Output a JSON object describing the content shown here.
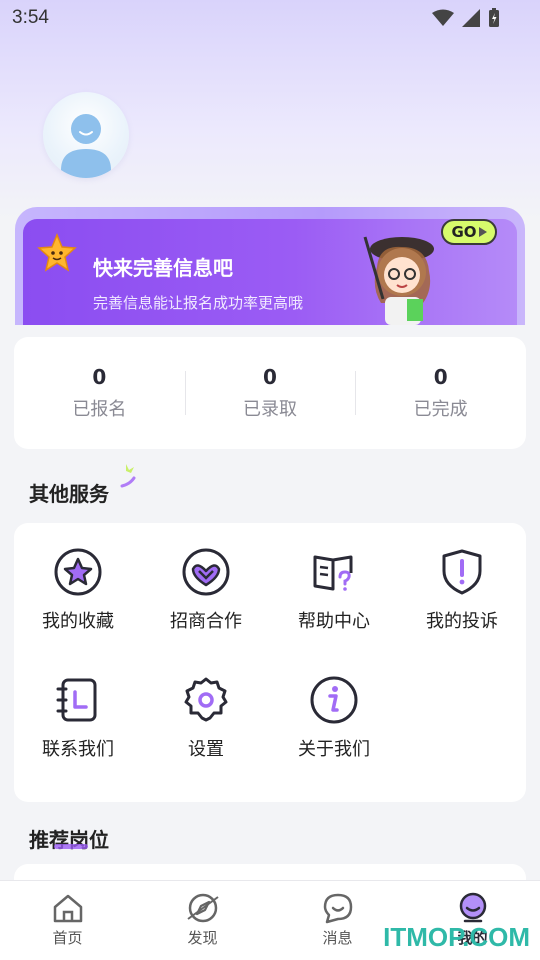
{
  "status_bar": {
    "time": "3:54"
  },
  "banner": {
    "title": "快来完善信息吧",
    "subtitle": "完善信息能让报名成功率更高哦",
    "go_label": "GO"
  },
  "stats": [
    {
      "value": "0",
      "label": "已报名"
    },
    {
      "value": "0",
      "label": "已录取"
    },
    {
      "value": "0",
      "label": "已完成"
    }
  ],
  "services_title": "其他服务",
  "services": [
    {
      "label": "我的收藏",
      "icon": "star-circle-icon"
    },
    {
      "label": "招商合作",
      "icon": "handshake-heart-icon"
    },
    {
      "label": "帮助中心",
      "icon": "help-book-icon"
    },
    {
      "label": "我的投诉",
      "icon": "shield-alert-icon"
    },
    {
      "label": "联系我们",
      "icon": "contact-book-icon"
    },
    {
      "label": "设置",
      "icon": "settings-gear-icon"
    },
    {
      "label": "关于我们",
      "icon": "info-icon"
    }
  ],
  "recommend_title": "推荐岗位",
  "tabs": [
    {
      "label": "首页",
      "icon": "home-icon"
    },
    {
      "label": "发现",
      "icon": "discover-icon"
    },
    {
      "label": "消息",
      "icon": "message-icon"
    },
    {
      "label": "我的",
      "icon": "profile-icon",
      "active": true
    }
  ],
  "watermark": "ITMOP.COM",
  "colors": {
    "accent": "#8b4df1",
    "accent_light": "#b59bfb",
    "go_badge": "#d7fb6c",
    "icon_stroke": "#2a2a36"
  }
}
